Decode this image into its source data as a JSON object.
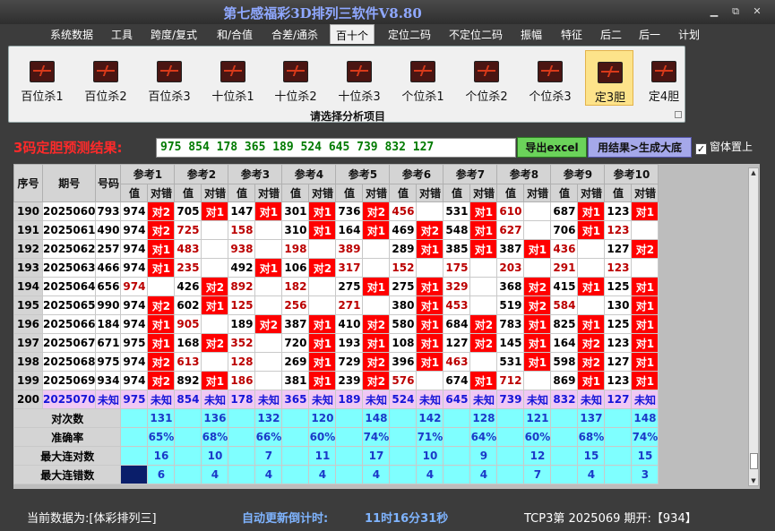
{
  "app": {
    "title": "第七感福彩3D排列三软件V8.80"
  },
  "window": {
    "minimize": "▁",
    "restore": "⧉",
    "close": "✕"
  },
  "menu": [
    "系统数据",
    "工具",
    "跨度/复式",
    "和/合值",
    "合差/通杀",
    "百十个",
    "定位二码",
    "不定位二码",
    "振幅",
    "特征",
    "后二",
    "后一",
    "计划"
  ],
  "menu_active": "百十个",
  "ribbon": {
    "buttons": [
      {
        "label": "百位杀1",
        "icon": "chart-icon"
      },
      {
        "label": "百位杀2",
        "icon": "chart-icon"
      },
      {
        "label": "百位杀3",
        "icon": "chart-icon"
      },
      {
        "label": "十位杀1",
        "icon": "chart-icon"
      },
      {
        "label": "十位杀2",
        "icon": "chart-icon"
      },
      {
        "label": "十位杀3",
        "icon": "chart-icon"
      },
      {
        "label": "个位杀1",
        "icon": "chart-icon"
      },
      {
        "label": "个位杀2",
        "icon": "chart-icon"
      },
      {
        "label": "个位杀3",
        "icon": "chart-icon"
      },
      {
        "label": "定3胆",
        "icon": "chart-icon",
        "selected": true
      },
      {
        "label": "定4胆",
        "icon": "chart-icon"
      }
    ],
    "caption": "请选择分析项目"
  },
  "predict": {
    "label": "3码定胆预测结果:",
    "value": "975 854 178 365 189 524 645 739 832 127",
    "export_label": "导出excel",
    "generate_label": "用结果>生成大底",
    "ontop_label": "窗体置上",
    "ontop_checked": "✓"
  },
  "grid": {
    "head": {
      "idx": "序号",
      "period": "期号",
      "code": "号码",
      "value": "值",
      "hit": "对错"
    },
    "refs": [
      "参考1",
      "参考2",
      "参考3",
      "参考4",
      "参考5",
      "参考6",
      "参考7",
      "参考8",
      "参考9",
      "参考10"
    ],
    "rows": [
      {
        "idx": "190",
        "period": "2025060",
        "code": "793",
        "cells": [
          [
            "974",
            "对2"
          ],
          [
            "705",
            "对1"
          ],
          [
            "147",
            "对1"
          ],
          [
            "301",
            "对1"
          ],
          [
            "736",
            "对2"
          ],
          [
            "456",
            ""
          ],
          [
            "531",
            "对1"
          ],
          [
            "610",
            ""
          ],
          [
            "687",
            "对1"
          ],
          [
            "123",
            "对1"
          ]
        ]
      },
      {
        "idx": "191",
        "period": "2025061",
        "code": "490",
        "cells": [
          [
            "974",
            "对2"
          ],
          [
            "725",
            ""
          ],
          [
            "158",
            ""
          ],
          [
            "310",
            "对1"
          ],
          [
            "164",
            "对1"
          ],
          [
            "469",
            "对2"
          ],
          [
            "548",
            "对1"
          ],
          [
            "627",
            ""
          ],
          [
            "706",
            "对1"
          ],
          [
            "123",
            ""
          ]
        ]
      },
      {
        "idx": "192",
        "period": "2025062",
        "code": "257",
        "cells": [
          [
            "974",
            "对1"
          ],
          [
            "483",
            ""
          ],
          [
            "938",
            ""
          ],
          [
            "198",
            ""
          ],
          [
            "389",
            ""
          ],
          [
            "289",
            "对1"
          ],
          [
            "385",
            "对1"
          ],
          [
            "387",
            "对1"
          ],
          [
            "436",
            ""
          ],
          [
            "127",
            "对2"
          ]
        ]
      },
      {
        "idx": "193",
        "period": "2025063",
        "code": "466",
        "cells": [
          [
            "974",
            "对1"
          ],
          [
            "235",
            ""
          ],
          [
            "492",
            "对1"
          ],
          [
            "106",
            "对2"
          ],
          [
            "317",
            ""
          ],
          [
            "152",
            ""
          ],
          [
            "175",
            ""
          ],
          [
            "203",
            ""
          ],
          [
            "291",
            ""
          ],
          [
            "123",
            ""
          ]
        ]
      },
      {
        "idx": "194",
        "period": "2025064",
        "code": "656",
        "cells": [
          [
            "974",
            ""
          ],
          [
            "426",
            "对2"
          ],
          [
            "892",
            ""
          ],
          [
            "182",
            ""
          ],
          [
            "275",
            "对1"
          ],
          [
            "275",
            "对1"
          ],
          [
            "329",
            ""
          ],
          [
            "368",
            "对2"
          ],
          [
            "415",
            "对1"
          ],
          [
            "125",
            "对1"
          ]
        ]
      },
      {
        "idx": "195",
        "period": "2025065",
        "code": "990",
        "cells": [
          [
            "974",
            "对2"
          ],
          [
            "602",
            "对1"
          ],
          [
            "125",
            ""
          ],
          [
            "256",
            ""
          ],
          [
            "271",
            ""
          ],
          [
            "380",
            "对1"
          ],
          [
            "453",
            ""
          ],
          [
            "519",
            "对2"
          ],
          [
            "584",
            ""
          ],
          [
            "130",
            "对1"
          ]
        ]
      },
      {
        "idx": "196",
        "period": "2025066",
        "code": "184",
        "cells": [
          [
            "974",
            "对1"
          ],
          [
            "905",
            ""
          ],
          [
            "189",
            "对2"
          ],
          [
            "387",
            "对1"
          ],
          [
            "410",
            "对2"
          ],
          [
            "580",
            "对1"
          ],
          [
            "684",
            "对2"
          ],
          [
            "783",
            "对1"
          ],
          [
            "825",
            "对1"
          ],
          [
            "125",
            "对1"
          ]
        ]
      },
      {
        "idx": "197",
        "period": "2025067",
        "code": "671",
        "cells": [
          [
            "975",
            "对1"
          ],
          [
            "168",
            "对2"
          ],
          [
            "352",
            ""
          ],
          [
            "720",
            "对1"
          ],
          [
            "193",
            "对1"
          ],
          [
            "108",
            "对1"
          ],
          [
            "127",
            "对2"
          ],
          [
            "145",
            "对1"
          ],
          [
            "164",
            "对2"
          ],
          [
            "123",
            "对1"
          ]
        ]
      },
      {
        "idx": "198",
        "period": "2025068",
        "code": "975",
        "cells": [
          [
            "974",
            "对2"
          ],
          [
            "613",
            ""
          ],
          [
            "128",
            ""
          ],
          [
            "269",
            "对1"
          ],
          [
            "729",
            "对2"
          ],
          [
            "396",
            "对1"
          ],
          [
            "463",
            ""
          ],
          [
            "531",
            "对1"
          ],
          [
            "598",
            "对2"
          ],
          [
            "127",
            "对1"
          ]
        ]
      },
      {
        "idx": "199",
        "period": "2025069",
        "code": "934",
        "cells": [
          [
            "974",
            "对2"
          ],
          [
            "892",
            "对1"
          ],
          [
            "186",
            ""
          ],
          [
            "381",
            "对1"
          ],
          [
            "239",
            "对2"
          ],
          [
            "576",
            ""
          ],
          [
            "674",
            "对1"
          ],
          [
            "712",
            ""
          ],
          [
            "869",
            "对1"
          ],
          [
            "123",
            "对1"
          ]
        ]
      }
    ],
    "future": {
      "idx": "200",
      "period": "2025070",
      "code": "未知",
      "values": [
        "975",
        "854",
        "178",
        "365",
        "189",
        "524",
        "645",
        "739",
        "832",
        "127"
      ],
      "status": "未知"
    },
    "stats": [
      {
        "label": "对次数",
        "values": [
          "131",
          "136",
          "132",
          "120",
          "148",
          "142",
          "128",
          "121",
          "137",
          "148"
        ]
      },
      {
        "label": "准确率",
        "values": [
          "65%",
          "68%",
          "66%",
          "60%",
          "74%",
          "71%",
          "64%",
          "60%",
          "68%",
          "74%"
        ]
      },
      {
        "label": "最大连对数",
        "values": [
          "16",
          "10",
          "7",
          "11",
          "17",
          "10",
          "9",
          "12",
          "15",
          "15"
        ]
      },
      {
        "label": "最大连错数",
        "values": [
          "6",
          "4",
          "4",
          "4",
          "4",
          "4",
          "4",
          "7",
          "4",
          "3"
        ]
      }
    ]
  },
  "status": {
    "source": "当前数据为:[体彩排列三]",
    "countdown_label": "自动更新倒计时:",
    "countdown": "11时16分31秒",
    "draw": "TCP3第 2025069 期开:【934】"
  },
  "colors": {
    "hit": "#ff0000",
    "future": "#f0c8f4",
    "stats": "#7fffff",
    "title": "#8fa8ff"
  }
}
